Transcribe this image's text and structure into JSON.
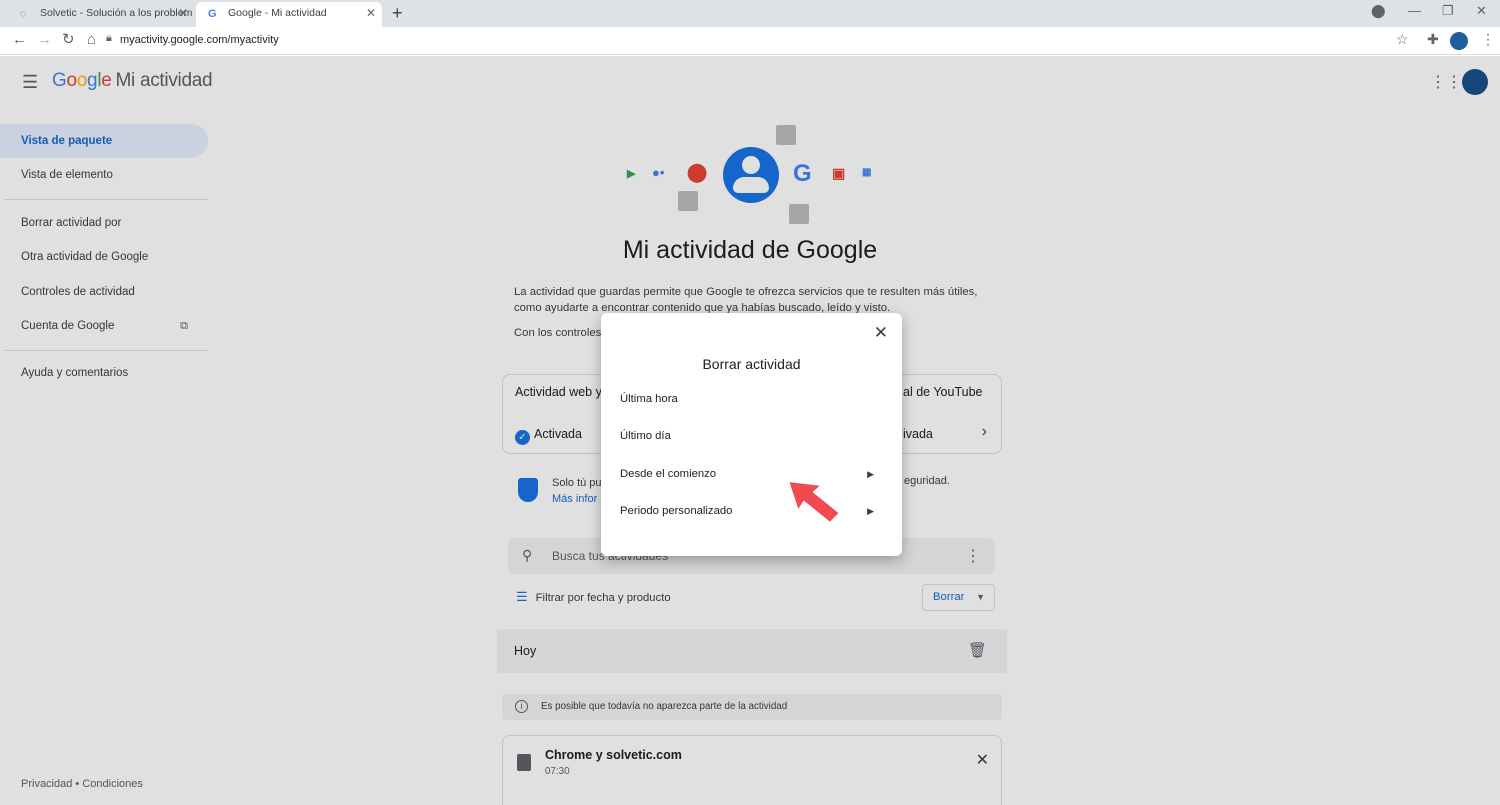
{
  "browser": {
    "tabs": [
      {
        "title": "Solvetic - Solución a los problem",
        "active": false
      },
      {
        "title": "Google - Mi actividad",
        "active": true
      }
    ],
    "url": "myactivity.google.com/myactivity"
  },
  "header": {
    "logo_letters": [
      "G",
      "o",
      "o",
      "g",
      "l",
      "e"
    ],
    "product": "Mi actividad"
  },
  "sidebar": {
    "items": [
      {
        "label": "Vista de paquete",
        "active": true
      },
      {
        "label": "Vista de elemento"
      },
      {
        "label": "Borrar actividad por"
      },
      {
        "label": "Otra actividad de Google"
      },
      {
        "label": "Controles de actividad"
      },
      {
        "label": "Cuenta de Google"
      },
      {
        "label": "Ayuda y comentarios"
      }
    ],
    "footer": "Privacidad  •  Condiciones"
  },
  "main": {
    "title": "Mi actividad de Google",
    "description": "La actividad que guardas permite que Google te ofrezca servicios que te resulten más útiles, como ayudarte a encontrar contenido que ya habías buscado, leído y visto.",
    "controls_text": "Con los controles",
    "card": {
      "left_title": "Actividad web y",
      "right_title": "al de YouTube",
      "left_status": "Activada",
      "right_status": "ivada"
    },
    "privacy": {
      "line1": "Solo tú pu",
      "link": "Más infor",
      "right": "eguridad."
    },
    "search_placeholder": "Busca tus actividades",
    "filter_label": "Filtrar por fecha y producto",
    "delete_button": "Borrar",
    "today_label": "Hoy",
    "notice": "Es posible que todavía no aparezca parte de la actividad",
    "entry": {
      "title": "Chrome y solvetic.com",
      "time": "07:30"
    }
  },
  "dialog": {
    "title": "Borrar actividad",
    "options": [
      {
        "label": "Última hora",
        "has_submenu": false
      },
      {
        "label": "Último día",
        "has_submenu": false
      },
      {
        "label": "Desde el comienzo",
        "has_submenu": true
      },
      {
        "label": "Periodo personalizado",
        "has_submenu": true
      }
    ]
  },
  "colors": {
    "accent": "#1a73e8",
    "pointer": "#ee4a4f"
  }
}
